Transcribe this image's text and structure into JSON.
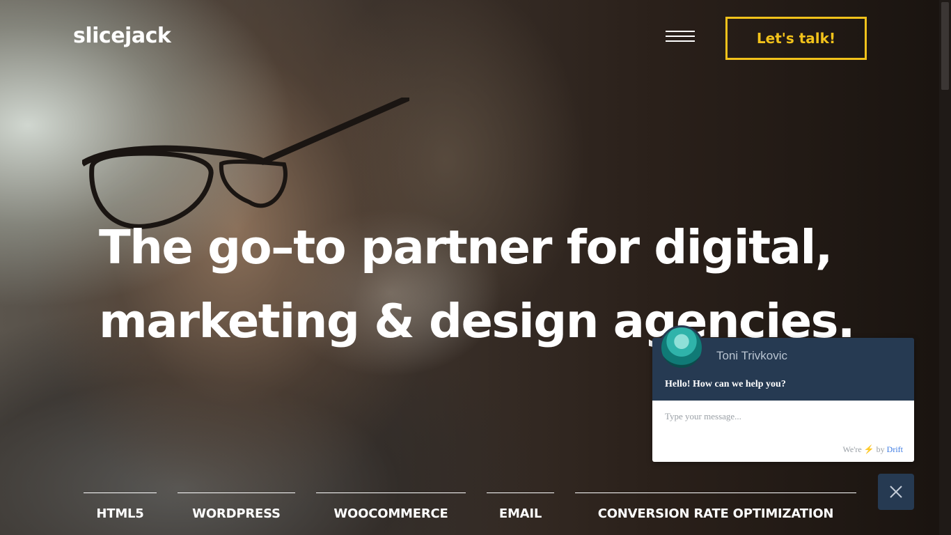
{
  "header": {
    "logo": "slicejack",
    "menu_icon": "hamburger-menu-icon",
    "cta_label": "Let's talk!",
    "accent_color": "#f2c21b"
  },
  "hero": {
    "headline_line1": "The go–to partner for digital,",
    "headline_line2": "marketing & design agencies."
  },
  "services": [
    {
      "label": "HTML5"
    },
    {
      "label": "WORDPRESS"
    },
    {
      "label": "WOOCOMMERCE"
    },
    {
      "label": "EMAIL"
    },
    {
      "label": "CONVERSION RATE OPTIMIZATION"
    }
  ],
  "chat": {
    "agent_name": "Toni Trivkovic",
    "greeting": "Hello! How can we help you?",
    "input_placeholder": "Type your message...",
    "powered_prefix": "We're",
    "powered_by": "by",
    "powered_brand": "Drift",
    "header_color": "#263a52",
    "close_icon": "close-icon"
  }
}
